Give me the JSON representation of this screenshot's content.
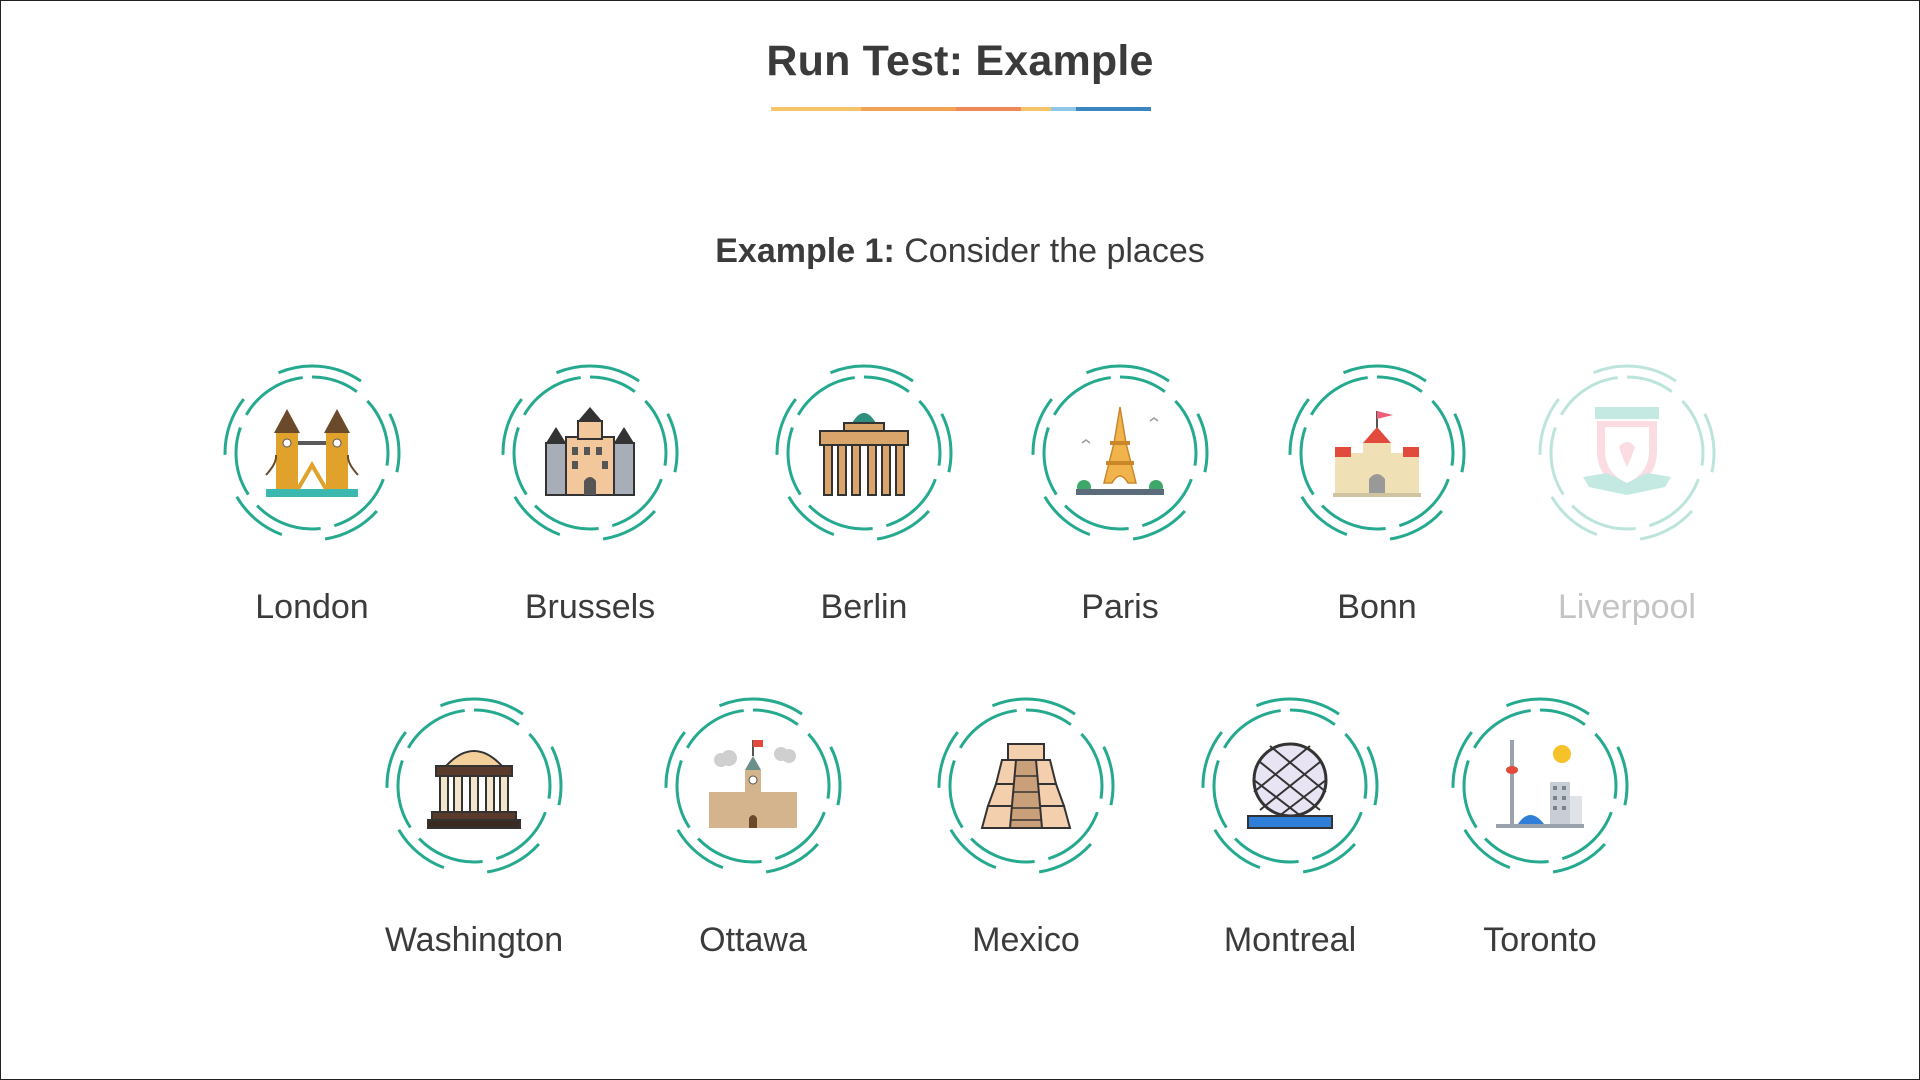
{
  "header": {
    "title": "Run Test: Example",
    "underline_colors": [
      "#f6c56b",
      "#f0a255",
      "#ee8a5a",
      "#f6c56b",
      "#8fc8e6",
      "#3b86c0"
    ]
  },
  "intro": {
    "lead": "Example 1:",
    "text": "Consider the places"
  },
  "colors": {
    "ring": "#25a98f",
    "title_text": "#3b3b3b",
    "faded_label": "#c4c4c4"
  },
  "places": [
    {
      "name": "London",
      "icon": "tower-bridge-icon",
      "faded": false
    },
    {
      "name": "Brussels",
      "icon": "city-hall-icon",
      "faded": false
    },
    {
      "name": "Berlin",
      "icon": "brandenburg-gate-icon",
      "faded": false
    },
    {
      "name": "Paris",
      "icon": "eiffel-tower-icon",
      "faded": false
    },
    {
      "name": "Bonn",
      "icon": "castle-icon",
      "faded": false
    },
    {
      "name": "Liverpool",
      "icon": "football-crest-icon",
      "faded": true
    },
    {
      "name": "Washington",
      "icon": "memorial-rotunda-icon",
      "faded": false
    },
    {
      "name": "Ottawa",
      "icon": "parliament-tower-icon",
      "faded": false
    },
    {
      "name": "Mexico",
      "icon": "pyramid-icon",
      "faded": false
    },
    {
      "name": "Montreal",
      "icon": "biosphere-dome-icon",
      "faded": false
    },
    {
      "name": "Toronto",
      "icon": "cn-tower-icon",
      "faded": false
    }
  ]
}
